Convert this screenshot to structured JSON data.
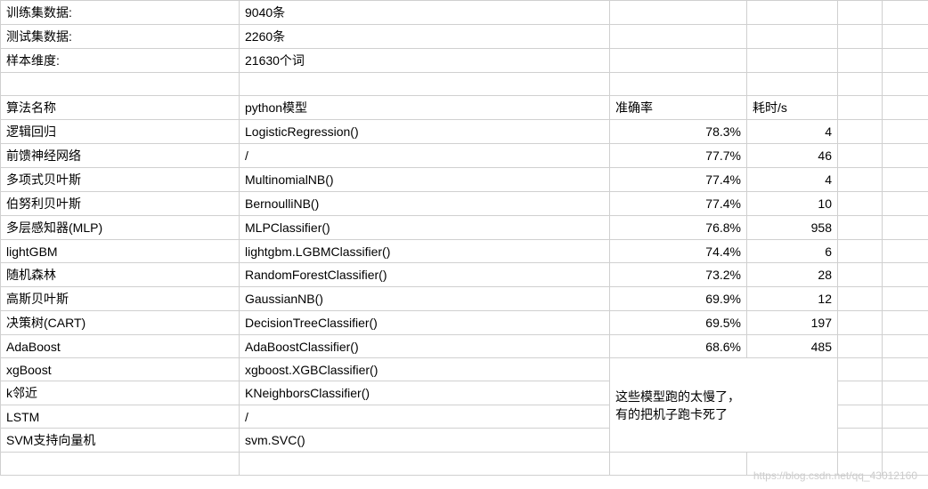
{
  "meta": {
    "trainLabel": "训练集数据:",
    "trainValue": "9040条",
    "testLabel": "测试集数据:",
    "testValue": "2260条",
    "dimLabel": "样本维度:",
    "dimValue": "21630个词"
  },
  "headers": {
    "algo": "算法名称",
    "model": "python模型",
    "acc": "准确率",
    "time": "耗时/s"
  },
  "rows": [
    {
      "algo": "逻辑回归",
      "model": "LogisticRegression()",
      "acc": "78.3%",
      "time": "4"
    },
    {
      "algo": "前馈神经网络",
      "model": "/",
      "acc": "77.7%",
      "time": "46"
    },
    {
      "algo": "多项式贝叶斯",
      "model": "MultinomialNB()",
      "acc": "77.4%",
      "time": "4"
    },
    {
      "algo": "伯努利贝叶斯",
      "model": "BernoulliNB()",
      "acc": "77.4%",
      "time": "10"
    },
    {
      "algo": "多层感知器(MLP)",
      "model": "MLPClassifier()",
      "acc": "76.8%",
      "time": "958"
    },
    {
      "algo": "lightGBM",
      "model": "lightgbm.LGBMClassifier()",
      "acc": "74.4%",
      "time": "6"
    },
    {
      "algo": "随机森林",
      "model": "RandomForestClassifier()",
      "acc": "73.2%",
      "time": "28"
    },
    {
      "algo": "高斯贝叶斯",
      "model": "GaussianNB()",
      "acc": "69.9%",
      "time": "12"
    },
    {
      "algo": "决策树(CART)",
      "model": "DecisionTreeClassifier()",
      "acc": "69.5%",
      "time": "197"
    },
    {
      "algo": "AdaBoost",
      "model": "AdaBoostClassifier()",
      "acc": "68.6%",
      "time": "485"
    }
  ],
  "slowRows": [
    {
      "algo": "xgBoost",
      "model": "xgboost.XGBClassifier()"
    },
    {
      "algo": "k邻近",
      "model": "KNeighborsClassifier()"
    },
    {
      "algo": "LSTM",
      "model": "/"
    },
    {
      "algo": "SVM支持向量机",
      "model": "svm.SVC()"
    }
  ],
  "slowNote": {
    "line1": "这些模型跑的太慢了，",
    "line2": "有的把机子跑卡死了"
  },
  "watermark": "https://blog.csdn.net/qq_43012160"
}
